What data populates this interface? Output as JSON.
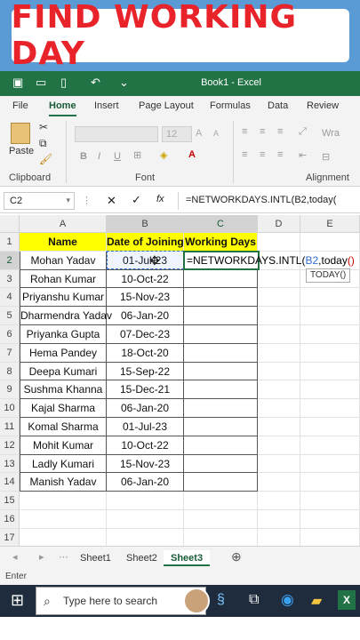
{
  "banner": {
    "title": "FIND WORKING DAY"
  },
  "window": {
    "title": "Book1 - Excel"
  },
  "ribbon_tabs": [
    "File",
    "Home",
    "Insert",
    "Page Layout",
    "Formulas",
    "Data",
    "Review"
  ],
  "ribbon": {
    "paste_label": "Paste",
    "font_size": "12",
    "clipboard_label": "Clipboard",
    "font_label": "Font",
    "alignment_label": "Alignment",
    "wrap_label": "Wra",
    "bold": "B",
    "italic": "I",
    "underline": "U"
  },
  "formula_bar": {
    "name_box": "C2",
    "fx": "fx",
    "formula": "=NETWORKDAYS.INTL(B2,today("
  },
  "columns": [
    "A",
    "B",
    "C",
    "D",
    "E"
  ],
  "rows": [
    "1",
    "2",
    "3",
    "4",
    "5",
    "6",
    "7",
    "8",
    "9",
    "10",
    "11",
    "12",
    "13",
    "14",
    "15",
    "16",
    "17"
  ],
  "headers": {
    "name": "Name",
    "date": "Date of Joining",
    "days": "Working Days"
  },
  "data_rows": [
    {
      "name": "Mohan Yadav",
      "date": "01-Jul-23"
    },
    {
      "name": "Rohan Kumar",
      "date": "10-Oct-22"
    },
    {
      "name": "Priyanshu Kumar",
      "date": "15-Nov-23"
    },
    {
      "name": "Dharmendra Yadav",
      "date": "06-Jan-20"
    },
    {
      "name": "Priyanka Gupta",
      "date": "07-Dec-23"
    },
    {
      "name": "Hema Pandey",
      "date": "18-Oct-20"
    },
    {
      "name": "Deepa Kumari",
      "date": "15-Sep-22"
    },
    {
      "name": "Sushma Khanna",
      "date": "15-Dec-21"
    },
    {
      "name": "Kajal Sharma",
      "date": "06-Jan-20"
    },
    {
      "name": "Komal Sharma",
      "date": "01-Jul-23"
    },
    {
      "name": "Mohit Kumar",
      "date": "10-Oct-22"
    },
    {
      "name": "Ladly Kumari",
      "date": "15-Nov-23"
    },
    {
      "name": "Manish Yadav",
      "date": "06-Jan-20"
    }
  ],
  "editing": {
    "cell_prefix": "=NETWORKDAYS.INTL(",
    "cell_ref": "B2",
    "cell_mid": ",today",
    "cell_paren": "()",
    "tooltip": "TODAY()"
  },
  "sheets": [
    "Sheet1",
    "Sheet2",
    "Sheet3"
  ],
  "status": {
    "mode": "Enter"
  },
  "taskbar": {
    "search_placeholder": "Type here to search"
  },
  "colors": {
    "excel_green": "#217346",
    "header_yellow": "#ffff00",
    "banner_red": "#e8232a",
    "banner_blue": "#5b9bd5"
  }
}
